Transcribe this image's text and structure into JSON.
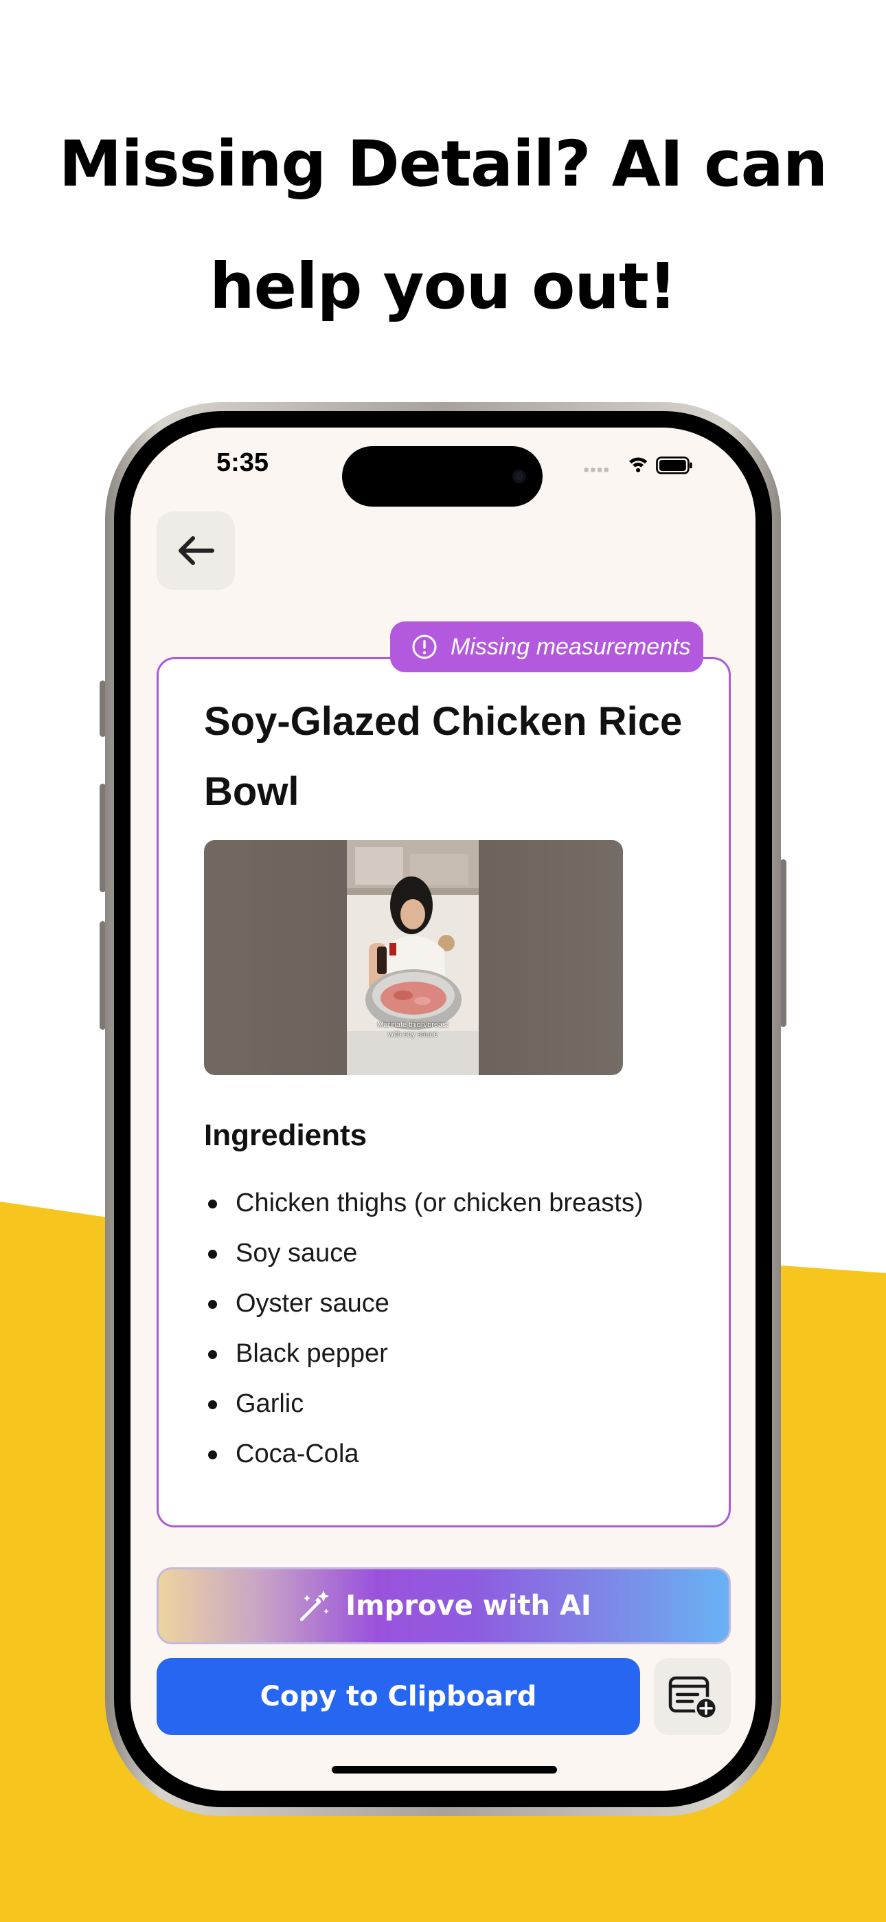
{
  "promo": {
    "headline_line1": "Missing Detail? AI can",
    "headline_line2": "help you out!",
    "background_accent": "#F6C51E"
  },
  "status_bar": {
    "time": "5:35",
    "icons": [
      "signal-icon",
      "wifi-icon",
      "battery-icon"
    ]
  },
  "nav": {
    "back_icon": "arrow-left-icon"
  },
  "recipe": {
    "warning_badge": "Missing measurements",
    "warning_icon": "exclamation-circle-icon",
    "title": "Soy-Glazed Chicken Rice Bowl",
    "thumbnail_caption_line1": "Marinate thigh/breast",
    "thumbnail_caption_line2": "with soy sauce",
    "ingredients_heading": "Ingredients",
    "ingredients": [
      "Chicken thighs (or chicken breasts)",
      "Soy sauce",
      "Oyster sauce",
      "Black pepper",
      "Garlic",
      "Coca-Cola"
    ]
  },
  "actions": {
    "improve_label": "Improve with AI",
    "improve_icon": "magic-wand-icon",
    "copy_label": "Copy to Clipboard",
    "add_list_icon": "list-add-icon"
  },
  "colors": {
    "accent_purple": "#B359DE",
    "primary_blue": "#2766F1",
    "screen_bg": "#FBF6F2"
  }
}
